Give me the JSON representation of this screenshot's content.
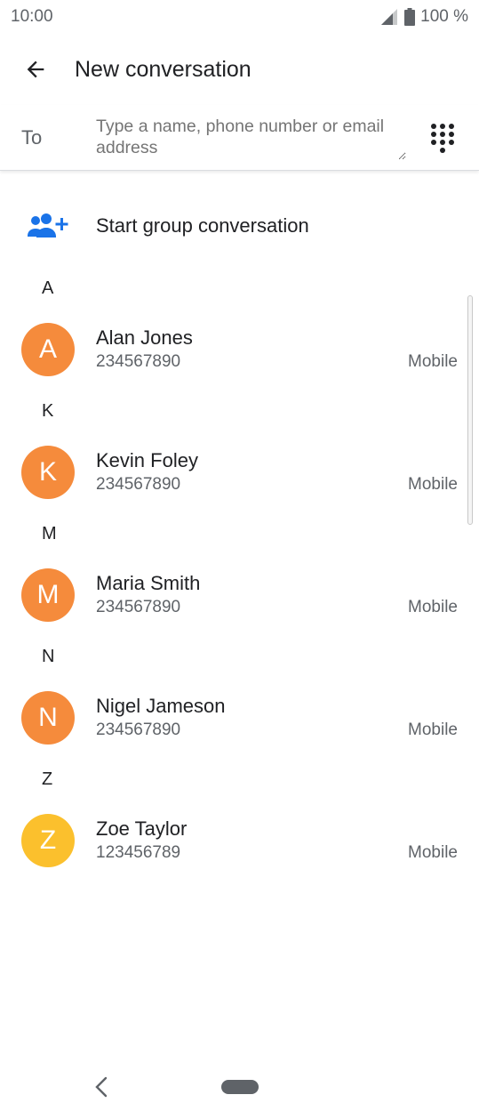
{
  "status_bar": {
    "time": "10:00",
    "battery_text": "100 %",
    "icons": [
      "signal-icon",
      "battery-icon"
    ]
  },
  "app_bar": {
    "title": "New conversation",
    "back_icon": "arrow-back-icon"
  },
  "recipient": {
    "to_label": "To",
    "placeholder": "Type a name, phone number or email address",
    "value": "",
    "dialpad_icon": "dialpad-icon"
  },
  "group": {
    "label": "Start group conversation",
    "icon": "group-add-icon",
    "accent": "#1a73e8"
  },
  "sections": [
    {
      "letter": "A",
      "contacts": [
        {
          "initial": "A",
          "name": "Alan Jones",
          "number": "234567890",
          "type": "Mobile",
          "color": "#f58b3c"
        }
      ]
    },
    {
      "letter": "K",
      "contacts": [
        {
          "initial": "K",
          "name": "Kevin Foley",
          "number": "234567890",
          "type": "Mobile",
          "color": "#f58b3c"
        }
      ]
    },
    {
      "letter": "M",
      "contacts": [
        {
          "initial": "M",
          "name": "Maria Smith",
          "number": "234567890",
          "type": "Mobile",
          "color": "#f58b3c"
        }
      ]
    },
    {
      "letter": "N",
      "contacts": [
        {
          "initial": "N",
          "name": "Nigel Jameson",
          "number": "234567890",
          "type": "Mobile",
          "color": "#f58b3c"
        }
      ]
    },
    {
      "letter": "Z",
      "contacts": [
        {
          "initial": "Z",
          "name": "Zoe Taylor",
          "number": "123456789",
          "type": "Mobile",
          "color": "#fbc02d"
        }
      ]
    }
  ],
  "nav_bar": {
    "back_icon": "nav-back-icon",
    "home_icon": "home-pill-icon"
  }
}
